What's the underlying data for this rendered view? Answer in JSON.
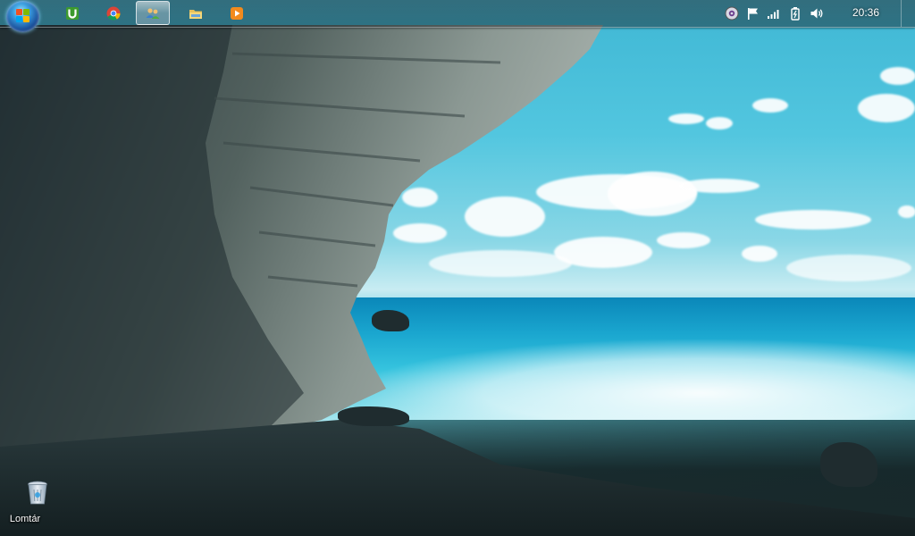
{
  "taskbar": {
    "start_button": "start-orb",
    "pinned_apps": [
      {
        "name": "utorrent",
        "icon": "utorrent-icon",
        "active": false
      },
      {
        "name": "chrome",
        "icon": "chrome-icon",
        "active": false
      },
      {
        "name": "user-accounts",
        "icon": "users-icon",
        "active": true
      },
      {
        "name": "windows-explorer",
        "icon": "folder-icon",
        "active": false
      },
      {
        "name": "media-player",
        "icon": "media-player-icon",
        "active": false
      }
    ],
    "tray_icons": [
      "steam-icon",
      "action-center-flag-icon",
      "network-signal-icon",
      "power-icon",
      "volume-icon"
    ]
  },
  "clock": {
    "time": "20:36"
  },
  "desktop": {
    "icons": [
      {
        "label": "Lomtár",
        "icon": "recycle-bin-icon"
      }
    ]
  },
  "colors": {
    "sky": "#52c6df",
    "sea": "#1aa6cf",
    "taskbar": "#1c2328",
    "orb": "#3b9fe0"
  }
}
